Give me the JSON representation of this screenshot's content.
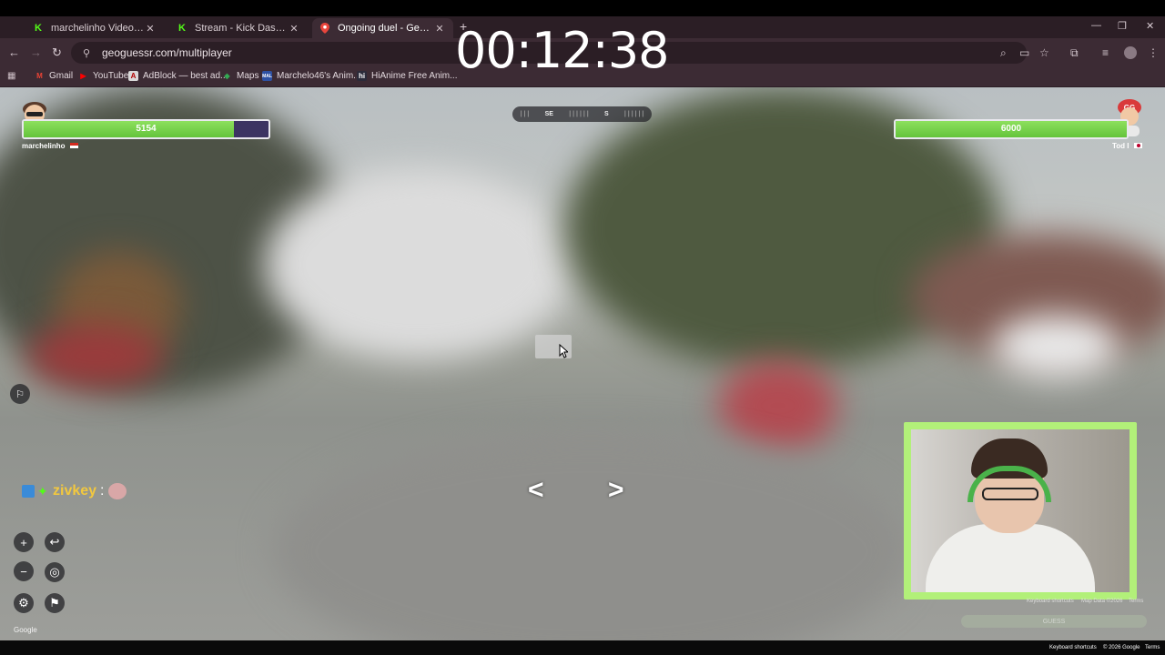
{
  "browser": {
    "tabs": [
      {
        "title": "marchelinho Videos - Watch Cl",
        "favicon": "K",
        "favicon_color": "#53fc18",
        "active": false
      },
      {
        "title": "Stream - Kick Dashboard",
        "favicon": "K",
        "favicon_color": "#53fc18",
        "active": false
      },
      {
        "title": "Ongoing duel - GeoGuessr",
        "favicon": "pin",
        "favicon_color": "#e8453c",
        "active": true
      }
    ],
    "url": "geoguessr.com/multiplayer",
    "bookmarks": [
      {
        "label": "Gmail",
        "icon": "gmail-icon",
        "color": "#ea4335",
        "glyph": "M"
      },
      {
        "label": "YouTube",
        "icon": "youtube-icon",
        "color": "#ff0000",
        "glyph": "▶"
      },
      {
        "label": "AdBlock — best ad...",
        "icon": "adblock-icon",
        "color": "#d9d9d9",
        "glyph": "A"
      },
      {
        "label": "Maps",
        "icon": "maps-icon",
        "color": "#34a853",
        "glyph": "◆"
      },
      {
        "label": "Marchelo46's Anim...",
        "icon": "mal-icon",
        "color": "#2e51a2",
        "glyph": "MAL"
      },
      {
        "label": "HiAnime Free Anim...",
        "icon": "hianime-icon",
        "color": "#2b2b3a",
        "glyph": "hi"
      }
    ],
    "window_controls": [
      "—",
      "❐",
      "✕"
    ]
  },
  "timer": "00:12:38",
  "game": {
    "compass": [
      "SE",
      "S"
    ],
    "player_left": {
      "name": "marchelinho",
      "score": "5154",
      "health_fraction": 0.86
    },
    "player_right": {
      "name": "Tod I",
      "score": "6000",
      "health_fraction": 1.0
    },
    "chat": {
      "user": "zivkey",
      "separator": ":"
    },
    "map_attrib": {
      "keyboard_shortcuts": "Keyboard shortcuts",
      "map_data": "Map Data ©2026",
      "terms": "Terms",
      "copyright": "© 2026 Google",
      "guess_button": "GUESS",
      "google_logo": "Google"
    },
    "controls": {
      "zoom_in": "+",
      "zoom_out": "−",
      "back": "↩",
      "location": "◎",
      "settings": "⚙",
      "flag": "⚑"
    },
    "nav_arrows": [
      "<",
      ">"
    ]
  }
}
